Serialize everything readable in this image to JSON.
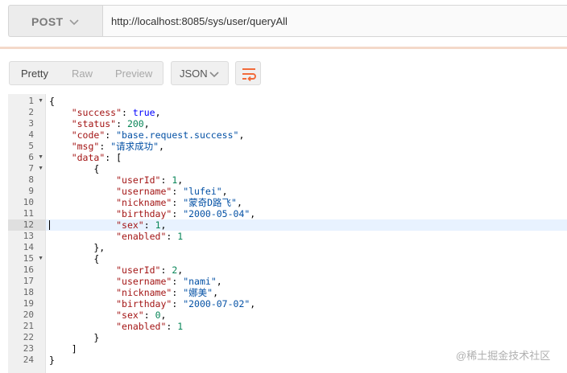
{
  "request": {
    "method": "POST",
    "url": "http://localhost:8085/sys/user/queryAll"
  },
  "response_toolbar": {
    "view_tabs": [
      {
        "label": "Pretty",
        "active": true
      },
      {
        "label": "Raw",
        "active": false
      },
      {
        "label": "Preview",
        "active": false
      }
    ],
    "format": "JSON",
    "wrap_icon": "wrap-lines-icon"
  },
  "editor": {
    "highlighted_line": 12,
    "lines": [
      {
        "n": "1",
        "fold": true,
        "text": "{"
      },
      {
        "n": "2",
        "fold": false,
        "text": "    \"success\": true,"
      },
      {
        "n": "3",
        "fold": false,
        "text": "    \"status\": 200,"
      },
      {
        "n": "4",
        "fold": false,
        "text": "    \"code\": \"base.request.success\","
      },
      {
        "n": "5",
        "fold": false,
        "text": "    \"msg\": \"请求成功\","
      },
      {
        "n": "6",
        "fold": true,
        "text": "    \"data\": ["
      },
      {
        "n": "7",
        "fold": true,
        "text": "        {"
      },
      {
        "n": "8",
        "fold": false,
        "text": "            \"userId\": 1,"
      },
      {
        "n": "9",
        "fold": false,
        "text": "            \"username\": \"lufei\","
      },
      {
        "n": "10",
        "fold": false,
        "text": "            \"nickname\": \"蒙奇D路飞\","
      },
      {
        "n": "11",
        "fold": false,
        "text": "            \"birthday\": \"2000-05-04\","
      },
      {
        "n": "12",
        "fold": false,
        "text": "            \"sex\": 1,"
      },
      {
        "n": "13",
        "fold": false,
        "text": "            \"enabled\": 1"
      },
      {
        "n": "14",
        "fold": false,
        "text": "        },"
      },
      {
        "n": "15",
        "fold": true,
        "text": "        {"
      },
      {
        "n": "16",
        "fold": false,
        "text": "            \"userId\": 2,"
      },
      {
        "n": "17",
        "fold": false,
        "text": "            \"username\": \"nami\","
      },
      {
        "n": "18",
        "fold": false,
        "text": "            \"nickname\": \"娜美\","
      },
      {
        "n": "19",
        "fold": false,
        "text": "            \"birthday\": \"2000-07-02\","
      },
      {
        "n": "20",
        "fold": false,
        "text": "            \"sex\": 0,"
      },
      {
        "n": "21",
        "fold": false,
        "text": "            \"enabled\": 1"
      },
      {
        "n": "22",
        "fold": false,
        "text": "        }"
      },
      {
        "n": "23",
        "fold": false,
        "text": "    ]"
      },
      {
        "n": "24",
        "fold": false,
        "text": "}"
      }
    ]
  },
  "syntax_colors": {
    "key": "#a31515",
    "string": "#0451a5",
    "number": "#098658",
    "boolean": "#0000ff",
    "punctuation": "#000000"
  },
  "accent_color": "#f26b3a",
  "watermark": "@稀土掘金技术社区"
}
